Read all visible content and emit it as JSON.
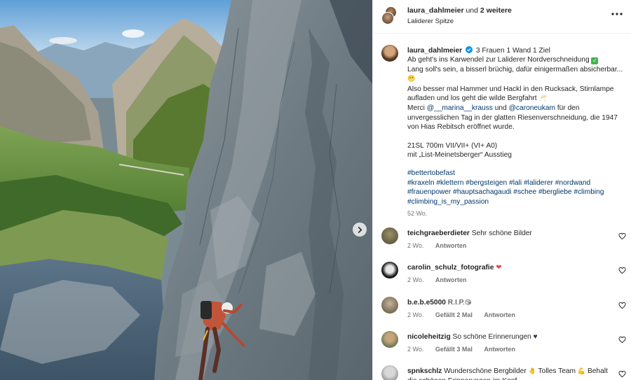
{
  "header": {
    "username": "laura_dahlmeier",
    "and_text": "und",
    "others": "2 weitere",
    "location": "Laliderer Spitze"
  },
  "caption": {
    "username": "laura_dahlmeier",
    "title": "3 Frauen 1 Wand 1 Ziel",
    "line1": "Ab geht's ins Karwendel zur Laliderer Nordverschneidung",
    "line2": "Lang soll's sein, a bisserl brüchig, dafür einigermaßen absicherbar...",
    "line3": "Also besser mal Hammer und Hackl in den Rucksack, Stirnlampe aufladen und los geht die wilde Bergfahrt",
    "line4_pre": "Merci",
    "mention1": "@__marina__krauss",
    "line4_mid": "und",
    "mention2": "@caroneukam",
    "line4_post": "für den unvergesslichen Tag in der glatten Riesenverschneidung, die 1947 von Hias Rebitsch eröffnet wurde.",
    "route_grade": "21SL 700m VII/VII+ (VI+ A0)",
    "route_exit": "mit „List-Meinetsberger“ Ausstieg",
    "hashtags": [
      "#bettertobefast",
      "#kraxeln",
      "#klettern",
      "#bergsteigen",
      "#lali",
      "#laliderer",
      "#nordwand",
      "#frauenpower",
      "#hauptsachagaudi",
      "#schee",
      "#bergliebe",
      "#climbing",
      "#climbing_is_my_passion"
    ],
    "time": "52 Wo."
  },
  "comments": [
    {
      "username": "teichgraeberdieter",
      "text": "Sehr schöne Bilder",
      "time": "2 Wo.",
      "likes": "",
      "reply": "Antworten"
    },
    {
      "username": "carolin_schulz_fotografie",
      "text": "",
      "emoji": "❤",
      "time": "2 Wo.",
      "likes": "",
      "reply": "Antworten"
    },
    {
      "username": "b.e.b.e5000",
      "text": "R.I.P.",
      "time": "2 Wo.",
      "likes": "Gefällt 2 Mal",
      "reply": "Antworten"
    },
    {
      "username": "nicoleheitzig",
      "text": "So schöne Erinnerungen",
      "time": "2 Wo.",
      "likes": "Gefällt 3 Mal",
      "reply": "Antworten"
    },
    {
      "username": "spnkschlz",
      "text": "Wunderschöne Bergbilder",
      "text2": "Tolles Team",
      "text3": "Behalt die schönen Erinnerungen im Kopf"
    }
  ],
  "icons": {
    "verified": "verified-badge-icon",
    "more": "more-options-icon",
    "next": "chevron-right-icon",
    "like": "heart-outline-icon"
  },
  "colors": {
    "link": "#00376b",
    "verified": "#0095f6",
    "meta": "#737373",
    "heart": "#ed4956"
  }
}
